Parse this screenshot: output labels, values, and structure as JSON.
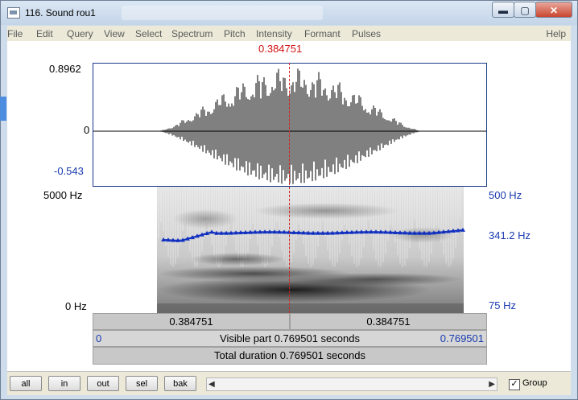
{
  "window": {
    "title": "116. Sound rou1",
    "minimize_glyph": "▬",
    "maximize_glyph": "▢",
    "close_glyph": "✕"
  },
  "menu": {
    "items": [
      "File",
      "Edit",
      "Query",
      "View",
      "Select",
      "Spectrum",
      "Pitch",
      "Intensity",
      "Formant",
      "Pulses"
    ],
    "help": "Help"
  },
  "cursor": {
    "time_label": "0.384751",
    "time": 0.384751
  },
  "waveform": {
    "max_label": "0.8962",
    "zero_label": "0",
    "min_label": "-0.543"
  },
  "spectrogram": {
    "top_freq_label": "5000 Hz",
    "bottom_freq_label": "0 Hz"
  },
  "pitch": {
    "top_label": "500 Hz",
    "current_label": "341.2 Hz",
    "bottom_label": "75 Hz"
  },
  "timebar": {
    "left_half": "0.384751",
    "right_half": "0.384751",
    "visible_start": "0",
    "visible_label": "Visible part 0.769501 seconds",
    "visible_end": "0.769501",
    "total_label": "Total duration 0.769501 seconds"
  },
  "bottom_buttons": [
    "all",
    "in",
    "out",
    "sel",
    "bak"
  ],
  "scrollbar": {
    "left_arrow": "◀",
    "right_arrow": "▶"
  },
  "group": {
    "label": "Group",
    "checked": true,
    "check_glyph": "✓"
  },
  "colors": {
    "cursor": "#d01010",
    "pitch": "#1030c0",
    "axis_blue": "#1a3ab0"
  }
}
